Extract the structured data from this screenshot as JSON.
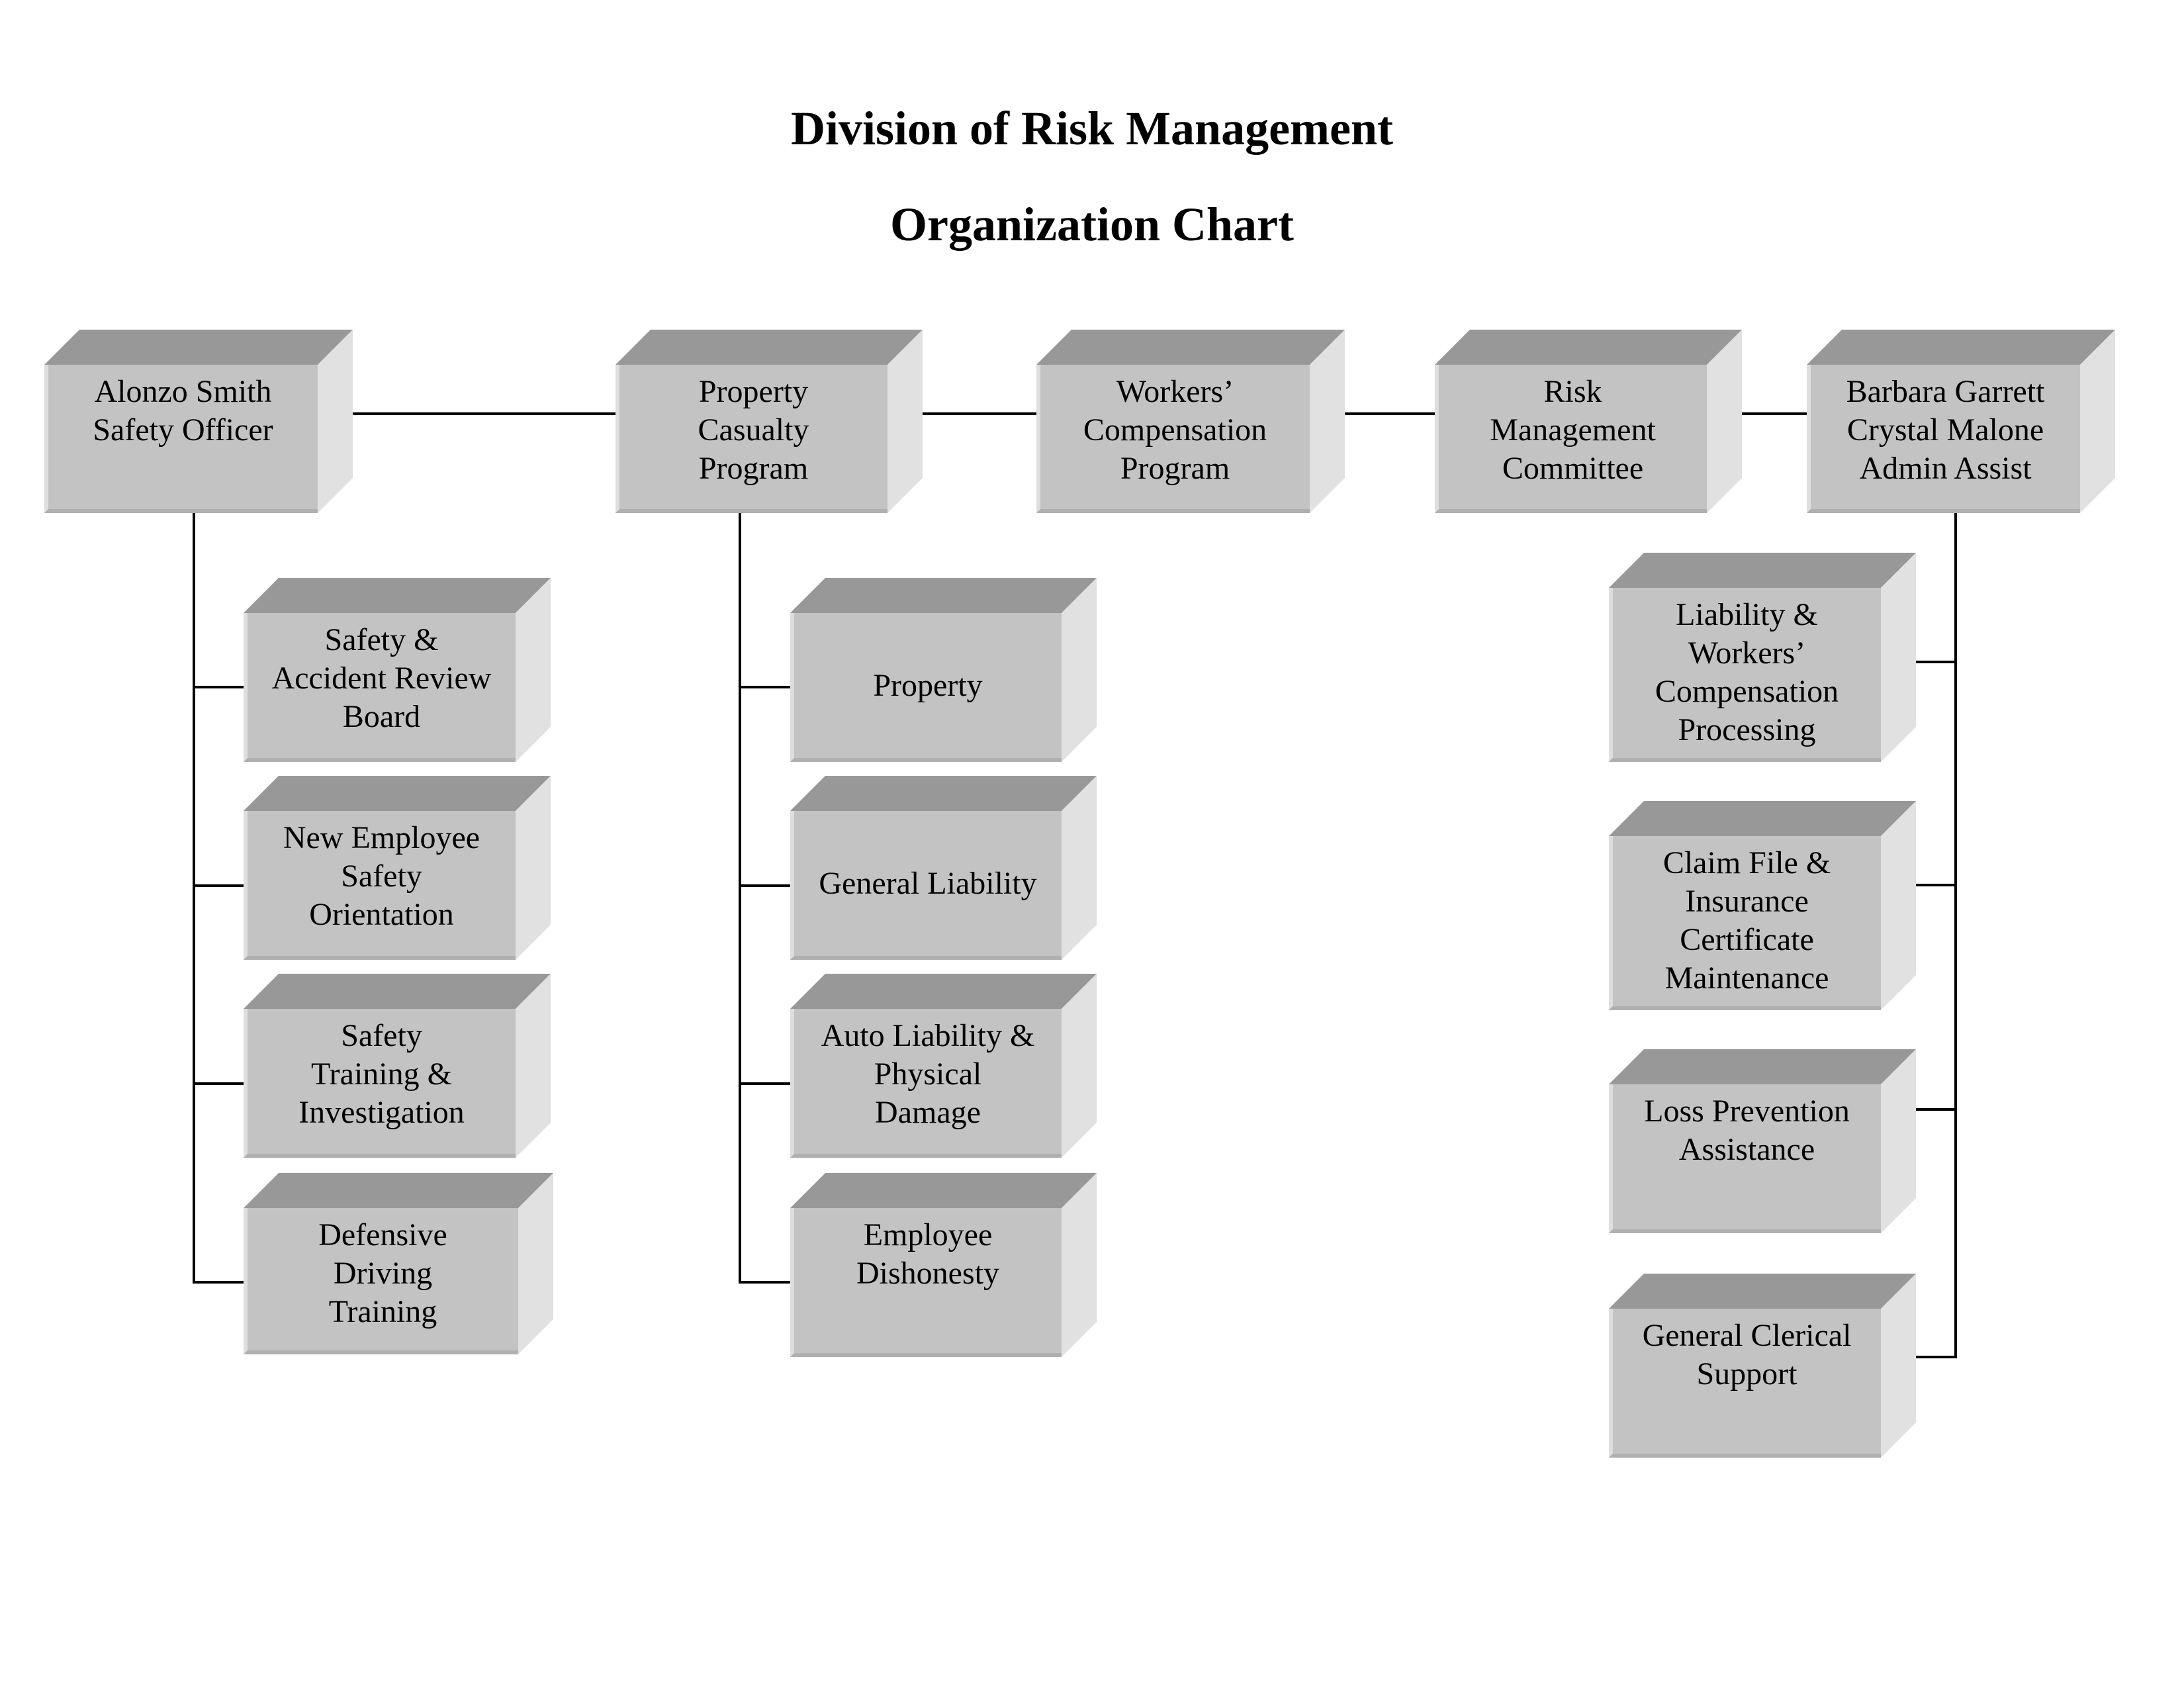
{
  "title": {
    "line1": "Division of Risk Management",
    "line2": "Organization Chart"
  },
  "colors": {
    "front_face": "#c3c3c3",
    "top_face": "#989898",
    "side_face": "#e1e1e1",
    "line": "#000000"
  },
  "top_row": [
    {
      "id": "safety-officer",
      "label": "Alonzo Smith\nSafety Officer"
    },
    {
      "id": "property-casualty-program",
      "label": "Property\nCasualty\nProgram"
    },
    {
      "id": "workers-compensation-program",
      "label": "Workers’\nCompensation\nProgram"
    },
    {
      "id": "risk-management-committee",
      "label": "Risk\nManagement\nCommittee"
    },
    {
      "id": "admin-assist",
      "label": "Barbara Garrett\nCrystal Malone\nAdmin Assist"
    }
  ],
  "safety_officer_children": [
    {
      "label": "Safety &\nAccident Review\nBoard"
    },
    {
      "label": "New Employee\nSafety\nOrientation"
    },
    {
      "label": "Safety\nTraining &\nInvestigation"
    },
    {
      "label": "Defensive\nDriving\nTraining"
    }
  ],
  "property_casualty_children": [
    {
      "label": "Property"
    },
    {
      "label": "General Liability"
    },
    {
      "label": "Auto Liability &\nPhysical\nDamage"
    },
    {
      "label": "Employee\nDishonesty"
    }
  ],
  "admin_assist_children": [
    {
      "label": "Liability &\nWorkers’\nCompensation\nProcessing"
    },
    {
      "label": "Claim File &\nInsurance\nCertificate\nMaintenance"
    },
    {
      "label": "Loss Prevention\nAssistance"
    },
    {
      "label": "General Clerical\nSupport"
    }
  ]
}
